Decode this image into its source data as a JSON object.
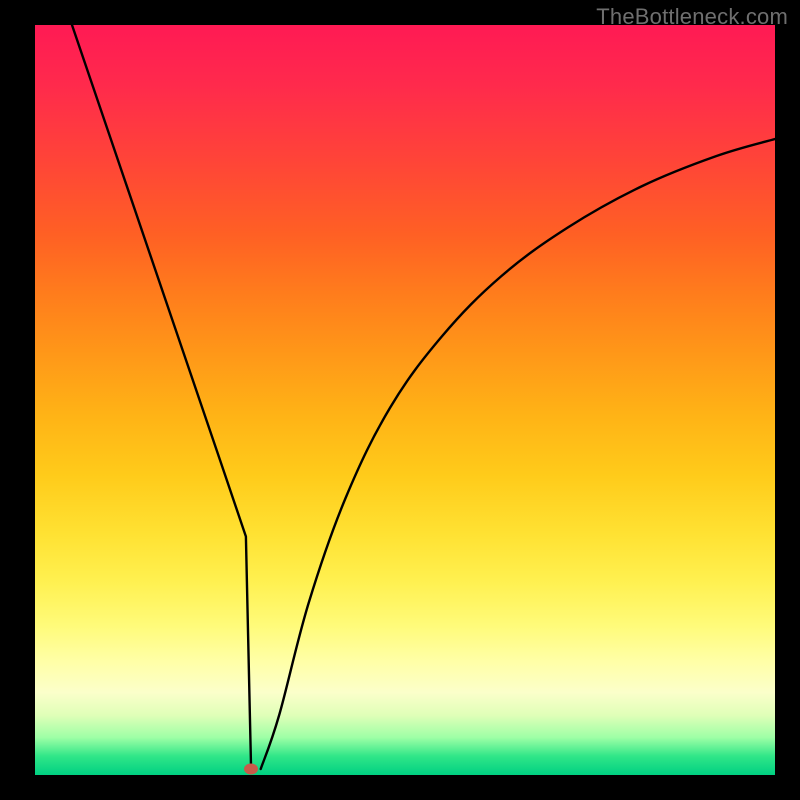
{
  "watermark": "TheBottleneck.com",
  "chart_data": {
    "type": "line",
    "title": "",
    "xlabel": "",
    "ylabel": "",
    "xlim": [
      0,
      100
    ],
    "ylim": [
      0,
      100
    ],
    "grid": false,
    "series": [
      {
        "name": "bottleneck-curve",
        "x": [
          5,
          10,
          15,
          20,
          25,
          28.5,
          29.2,
          30.5,
          33,
          37,
          42,
          48,
          55,
          63,
          72,
          82,
          92,
          100
        ],
        "y": [
          100,
          85.5,
          71,
          56.5,
          42,
          31.8,
          0.8,
          0.8,
          8,
          23,
          37,
          49,
          58.5,
          66.5,
          73,
          78.5,
          82.5,
          84.8
        ]
      }
    ],
    "marker": {
      "x": 29.2,
      "y": 0.8,
      "color": "#c85a4a"
    },
    "background_gradient": {
      "top": "#ff1a54",
      "middle": "#ffe233",
      "bottom": "#00d082"
    }
  }
}
